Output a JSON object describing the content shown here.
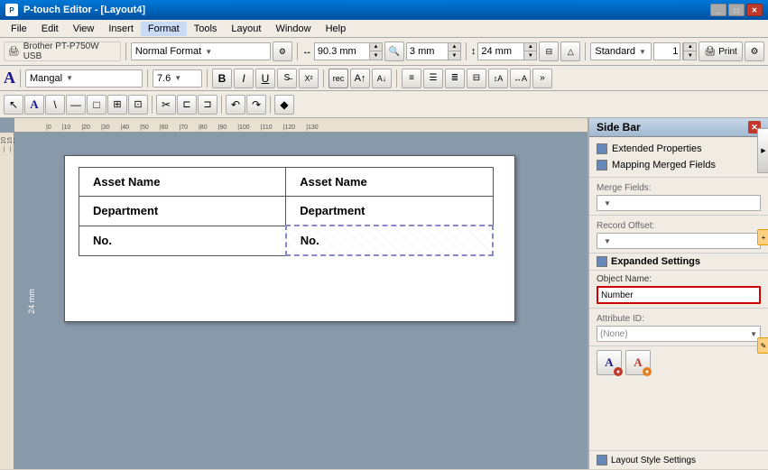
{
  "window": {
    "title": "P-touch Editor - [Layout4]",
    "icon": "P"
  },
  "menu": {
    "items": [
      "File",
      "Edit",
      "View",
      "Insert",
      "Format",
      "Tools",
      "Layout",
      "Window",
      "Help"
    ]
  },
  "toolbar1": {
    "printer": "Brother PT-P750W USB",
    "format_dropdown": "Normal Format",
    "width_value": "90.3 mm",
    "margin_value": "3 mm",
    "height_value": "24 mm",
    "standard_label": "Standard",
    "number_value": "1"
  },
  "format_toolbar": {
    "font": "Mangal",
    "size": "7.6",
    "bold": "B",
    "italic": "I",
    "underline": "U"
  },
  "tools": {
    "items": [
      "↖",
      "A",
      "\\",
      "—",
      "□",
      "⊞",
      "⊡",
      "✂",
      "⊏",
      "⊐",
      "↶",
      "↷",
      "◆"
    ]
  },
  "sidebar": {
    "title": "Side Bar",
    "sections": {
      "extended_properties": "Extended Properties",
      "mapping_merged_fields": "Mapping Merged Fields",
      "merge_fields_label": "Merge Fields:",
      "record_offset_label": "Record Offset:",
      "expanded_settings": "Expanded Settings",
      "object_name_label": "Object Name:",
      "object_name_value": "Number",
      "attribute_id_label": "Attribute ID:",
      "attribute_id_value": "(None)",
      "layout_style_settings": "Layout Style Settings"
    }
  },
  "label": {
    "rows": [
      [
        "Asset Name",
        "Asset Name"
      ],
      [
        "Department",
        "Department"
      ],
      [
        "No.",
        "No."
      ]
    ],
    "selected_row": 2,
    "selected_col": 1,
    "dimension": "24 mm"
  },
  "ruler": {
    "h_ticks": [
      "0",
      "10",
      "20",
      "30",
      "40",
      "50",
      "60",
      "70",
      "80",
      "90",
      "100",
      "110",
      "120",
      "130"
    ],
    "unit": "mm"
  }
}
